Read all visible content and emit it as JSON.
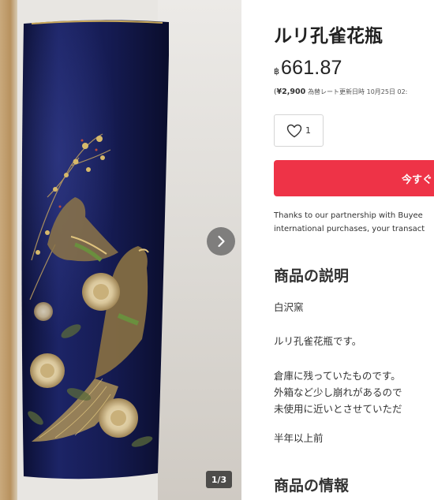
{
  "gallery": {
    "counter": "1/3",
    "next_icon": "chevron-right-icon"
  },
  "product": {
    "title": "ルリ孔雀花瓶",
    "currency_symbol": "฿",
    "price": "661.87",
    "rate_open": "(",
    "yen_price": "¥2,900",
    "rate_text": "為替レート更新日時 10月25日 02:",
    "likes": "1",
    "like_icon": "heart-icon",
    "buy_label": "今すぐ",
    "partner_note_line1": "Thanks to our partnership with Buyee",
    "partner_note_line2": "international purchases, your transact"
  },
  "description": {
    "heading": "商品の説明",
    "line1": "白沢窯",
    "line2": "ルリ孔雀花瓶です。",
    "line3": "倉庫に残っていたものです。",
    "line4": "外箱など少し崩れがあるので",
    "line5": "未使用に近いとさせていただ",
    "line6": "半年以上前"
  },
  "info_section": {
    "heading": "商品の情報"
  },
  "colors": {
    "buy_button": "#ee3347",
    "vase_body": "#141a4a",
    "gold": "#c9a85a"
  }
}
